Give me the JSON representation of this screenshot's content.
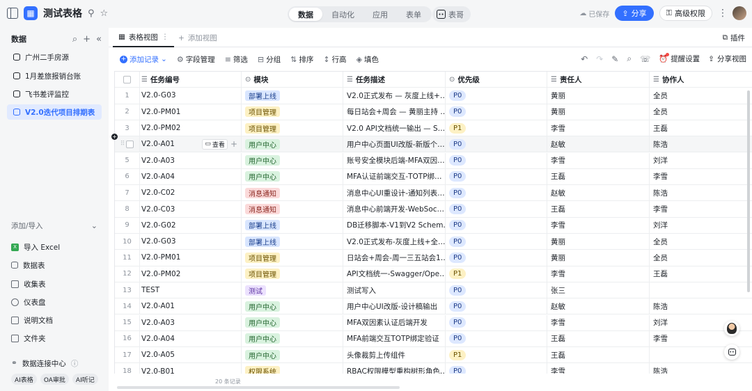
{
  "app": {
    "title": "测试表格"
  },
  "topnav": {
    "tabs": [
      "数据",
      "自动化",
      "应用",
      "表单"
    ],
    "ai_label": "表哥",
    "saved": "已保存",
    "share": "分享",
    "permissions": "高级权限"
  },
  "sidebar": {
    "title": "数据",
    "tables": [
      "广州二手房源",
      "1月差旅报销台账",
      "飞书差评监控",
      "V2.0迭代项目排期表"
    ],
    "section_label": "添加/导入",
    "tools": [
      "导入 Excel",
      "数据表",
      "收集表",
      "仪表盘",
      "说明文档",
      "文件夹"
    ],
    "connector": "数据连接中心",
    "tags": [
      "AI表格",
      "OA审批",
      "AI听记"
    ]
  },
  "viewtabs": {
    "active": "表格视图",
    "add": "添加视图",
    "plugin": "插件"
  },
  "toolbar": {
    "add_record": "添加记录",
    "fields": "字段管理",
    "filter": "筛选",
    "group": "分组",
    "sort": "排序",
    "row_height": "行高",
    "fill": "填色",
    "reminder": "提醒设置",
    "share_view": "分享视图"
  },
  "table": {
    "headers": [
      "任务编号",
      "模块",
      "任务描述",
      "优先级",
      "责任人",
      "协作人"
    ],
    "view_btn": "查看",
    "rows": [
      {
        "n": "1",
        "code": "V2.0-G03",
        "mod": "部署上线",
        "desc": "V2.0正式发布 — 灰度上线+…",
        "pri": "P0",
        "own": "黄丽",
        "col": "全员"
      },
      {
        "n": "2",
        "code": "V2.0-PM01",
        "mod": "项目管理",
        "desc": "每日站会+周会 — 黄丽主持 …",
        "pri": "P0",
        "own": "黄丽",
        "col": "全员"
      },
      {
        "n": "3",
        "code": "V2.0-PM02",
        "mod": "项目管理",
        "desc": "V2.0 API文档统一输出 — S…",
        "pri": "P1",
        "own": "李雪",
        "col": "王磊"
      },
      {
        "n": "",
        "code": "V2.0-A01",
        "mod": "用户中心",
        "desc": "用户中心页面UI改版-新版个…",
        "pri": "P0",
        "own": "赵敏",
        "col": "陈浩"
      },
      {
        "n": "5",
        "code": "V2.0-A03",
        "mod": "用户中心",
        "desc": "账号安全模块后端-MFA双因…",
        "pri": "P0",
        "own": "李雪",
        "col": "刘洋"
      },
      {
        "n": "6",
        "code": "V2.0-A04",
        "mod": "用户中心",
        "desc": "MFA认证前端交互-TOTP绑…",
        "pri": "P0",
        "own": "王磊",
        "col": "李雪"
      },
      {
        "n": "7",
        "code": "V2.0-C02",
        "mod": "消息通知",
        "desc": "消息中心UI重设计-通知列表…",
        "pri": "P0",
        "own": "赵敏",
        "col": "陈浩"
      },
      {
        "n": "8",
        "code": "V2.0-C03",
        "mod": "消息通知",
        "desc": "消息中心前端开发-WebSoc…",
        "pri": "P0",
        "own": "王磊",
        "col": "李雪"
      },
      {
        "n": "9",
        "code": "V2.0-G02",
        "mod": "部署上线",
        "desc": "DB迁移脚本-V1到V2 Schem…",
        "pri": "P0",
        "own": "李雪",
        "col": "刘洋"
      },
      {
        "n": "10",
        "code": "V2.0-G03",
        "mod": "部署上线",
        "desc": "V2.0正式发布-灰度上线+全…",
        "pri": "P0",
        "own": "黄丽",
        "col": "全员"
      },
      {
        "n": "11",
        "code": "V2.0-PM01",
        "mod": "项目管理",
        "desc": "日站会+周会-周一三五站会1…",
        "pri": "P0",
        "own": "黄丽",
        "col": "全员"
      },
      {
        "n": "12",
        "code": "V2.0-PM02",
        "mod": "项目管理",
        "desc": "API文档统一-Swagger/Ope…",
        "pri": "P1",
        "own": "李雪",
        "col": "王磊"
      },
      {
        "n": "13",
        "code": "TEST",
        "mod": "测试",
        "desc": "测试写入",
        "pri": "P0",
        "own": "张三",
        "col": ""
      },
      {
        "n": "14",
        "code": "V2.0-A01",
        "mod": "用户中心",
        "desc": "用户中心UI改版-设计稿输出",
        "pri": "P0",
        "own": "赵敏",
        "col": "陈浩"
      },
      {
        "n": "15",
        "code": "V2.0-A03",
        "mod": "用户中心",
        "desc": "MFA双因素认证后端开发",
        "pri": "P0",
        "own": "李雪",
        "col": "刘洋"
      },
      {
        "n": "16",
        "code": "V2.0-A04",
        "mod": "用户中心",
        "desc": "MFA前端交互TOTP绑定验证",
        "pri": "P0",
        "own": "王磊",
        "col": "李雪"
      },
      {
        "n": "17",
        "code": "V2.0-A05",
        "mod": "用户中心",
        "desc": "头像裁剪上传组件",
        "pri": "P1",
        "own": "王磊",
        "col": ""
      },
      {
        "n": "18",
        "code": "V2.0-B01",
        "mod": "权限系统",
        "desc": "RBAC权限模型重构树形角色…",
        "pri": "P0",
        "own": "李雪",
        "col": "陈浩"
      }
    ],
    "record_count": "20 条记录"
  },
  "colors": {
    "accent": "#3370ff"
  }
}
